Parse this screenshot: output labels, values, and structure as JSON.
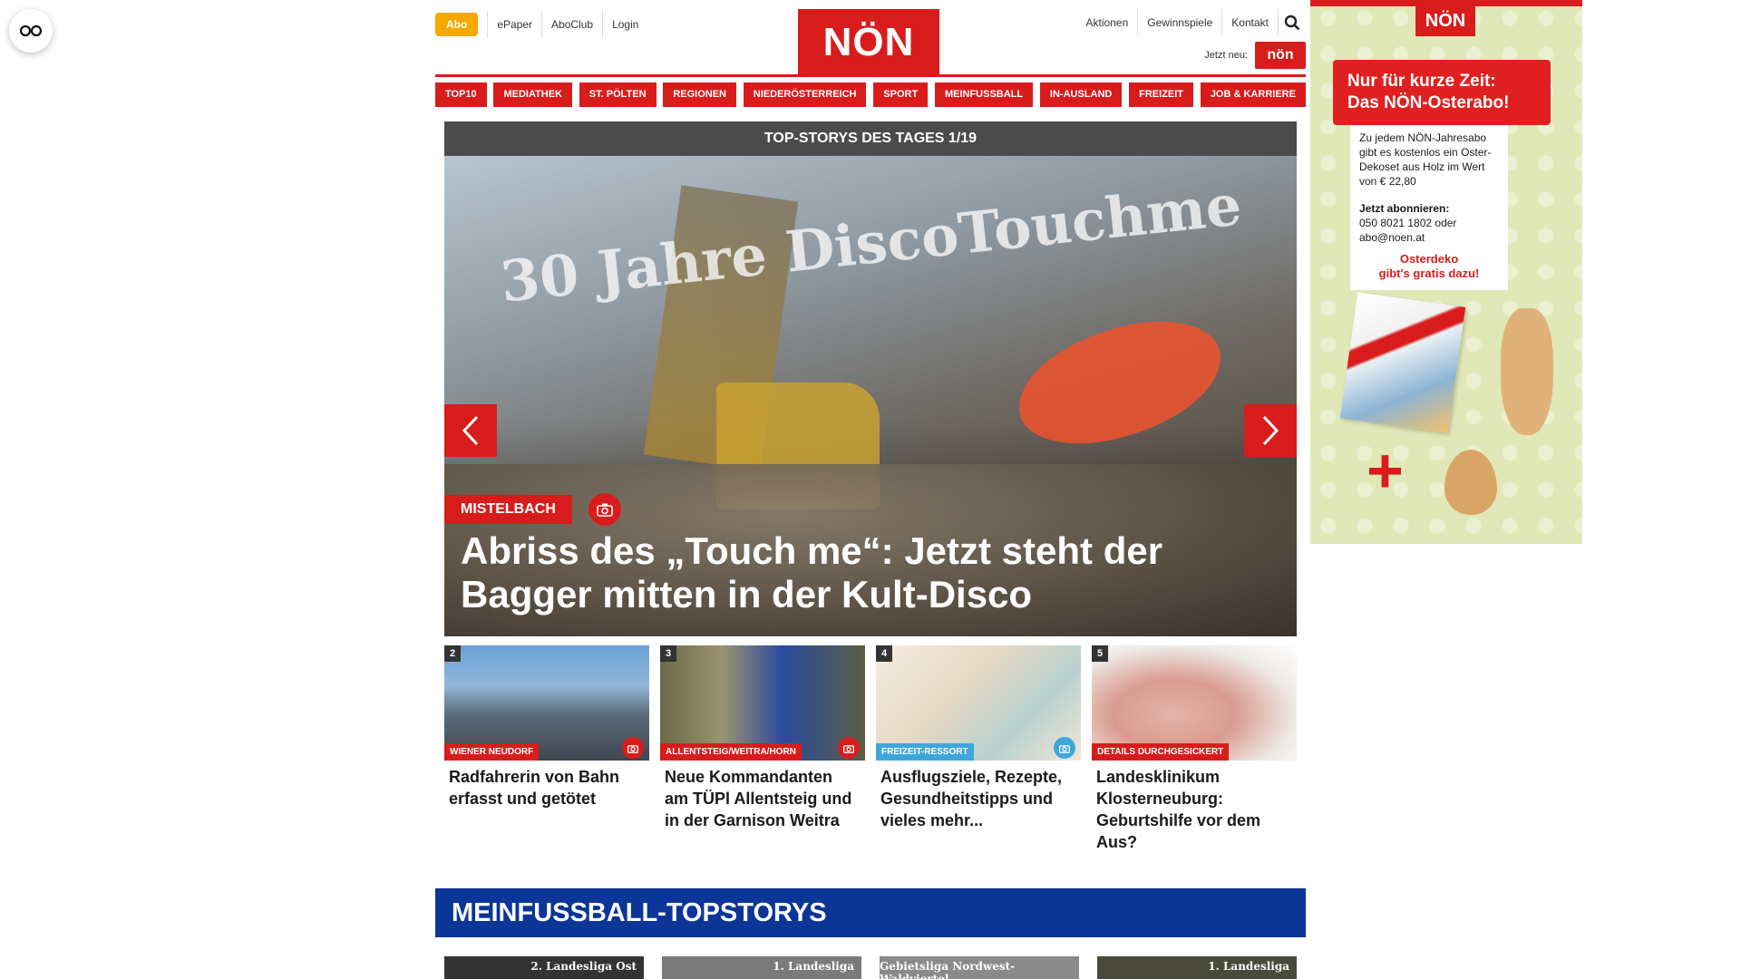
{
  "header": {
    "abo": "Abo",
    "links_left": [
      "ePaper",
      "AboClub",
      "Login"
    ],
    "logo": "NÖN",
    "links_right": [
      "Aktionen",
      "Gewinnspiele",
      "Kontakt"
    ],
    "jetzt_label": "Jetzt neu:",
    "jetzt_logo": "nön"
  },
  "nav": [
    "TOP10",
    "MEDIATHEK",
    "ST. PÖLTEN",
    "REGIONEN",
    "NIEDERÖSTERREICH",
    "SPORT",
    "MEINFUSSBALL",
    "IN-AUSLAND",
    "FREIZEIT",
    "JOB & KARRIERE"
  ],
  "slider": {
    "bar": "TOP-STORYS DES TAGES 1/19",
    "photo_text": "30 Jahre DiscoTouchme",
    "category": "MISTELBACH",
    "headline": "Abriss des „Touch me“: Jetzt steht der Bagger mitten in der Kult-Disco"
  },
  "cards": [
    {
      "num": "2",
      "tag": "WIENER NEUDORF",
      "title": "Radfahrerin von Bahn erfasst und getötet"
    },
    {
      "num": "3",
      "tag": "ALLENTSTEIG/WEITRA/HORN",
      "title": "Neue Kommandanten am TÜPl Allentsteig und in der Garnison Weitra"
    },
    {
      "num": "4",
      "tag": "FREIZEIT-RESSORT",
      "title": "Ausflugsziele, Rezepte, Gesundheitstipps und vieles mehr..."
    },
    {
      "num": "5",
      "tag": "DETAILS DURCHGESICKERT",
      "title": "Landesklinikum Klosterneuburg: Geburtshilfe vor dem Aus?"
    }
  ],
  "meinfussball": {
    "title": "MEINFUSSBALL-TOPSTORYS",
    "cards": [
      "2. Landesliga Ost",
      "1. Landesliga",
      "Gebietsliga Nordwest-Waldviertel",
      "1. Landesliga"
    ]
  },
  "ad": {
    "logo": "NÖN",
    "banner_line1": "Nur für kurze Zeit:",
    "banner_line2": "Das NÖN-Osterabo!",
    "text1": "Zu jedem NÖN-Jahresabo gibt es kostenlos ein Oster-Dekoset aus Holz im Wert von € 22,80",
    "subscribe_label": "Jetzt abonnieren:",
    "subscribe_contact": "050 8021 1802 oder abo@noen.at",
    "promo_line1": "Osterdeko",
    "promo_line2": "gibt's gratis dazu!"
  },
  "colors": {
    "brand_red": "#d81c1c",
    "abo_orange": "#f5a800",
    "fussball_blue": "#0b3596",
    "freizeit_blue": "#3fa6dc"
  }
}
